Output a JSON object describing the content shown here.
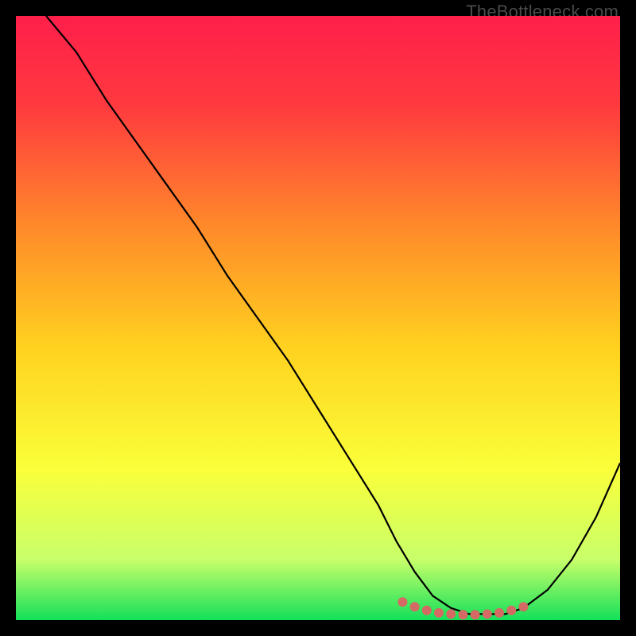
{
  "watermark": "TheBottleneck.com",
  "chart_data": {
    "type": "line",
    "title": "",
    "xlabel": "",
    "ylabel": "",
    "xlim": [
      0,
      100
    ],
    "ylim": [
      0,
      100
    ],
    "gradient_stops": [
      {
        "offset": 0.0,
        "color": "#ff1f4b"
      },
      {
        "offset": 0.15,
        "color": "#ff3a3f"
      },
      {
        "offset": 0.35,
        "color": "#ff8a2a"
      },
      {
        "offset": 0.55,
        "color": "#ffd21f"
      },
      {
        "offset": 0.75,
        "color": "#faff3a"
      },
      {
        "offset": 0.9,
        "color": "#c8ff6a"
      },
      {
        "offset": 1.0,
        "color": "#13e05a"
      }
    ],
    "series": [
      {
        "name": "bottleneck-curve",
        "x": [
          5,
          10,
          15,
          20,
          25,
          30,
          35,
          40,
          45,
          50,
          55,
          60,
          63,
          66,
          69,
          72,
          75,
          78,
          81,
          84,
          88,
          92,
          96,
          100
        ],
        "values": [
          100,
          94,
          86,
          79,
          72,
          65,
          57,
          50,
          43,
          35,
          27,
          19,
          13,
          8,
          4,
          2,
          1,
          1,
          1,
          2,
          5,
          10,
          17,
          26
        ]
      }
    ],
    "highlight_dots": {
      "name": "min-region",
      "color": "#d46a63",
      "x": [
        64,
        66,
        68,
        70,
        72,
        74,
        76,
        78,
        80,
        82,
        84
      ],
      "values": [
        3,
        2.2,
        1.6,
        1.2,
        1.0,
        0.9,
        0.9,
        1.0,
        1.2,
        1.6,
        2.2
      ]
    }
  }
}
